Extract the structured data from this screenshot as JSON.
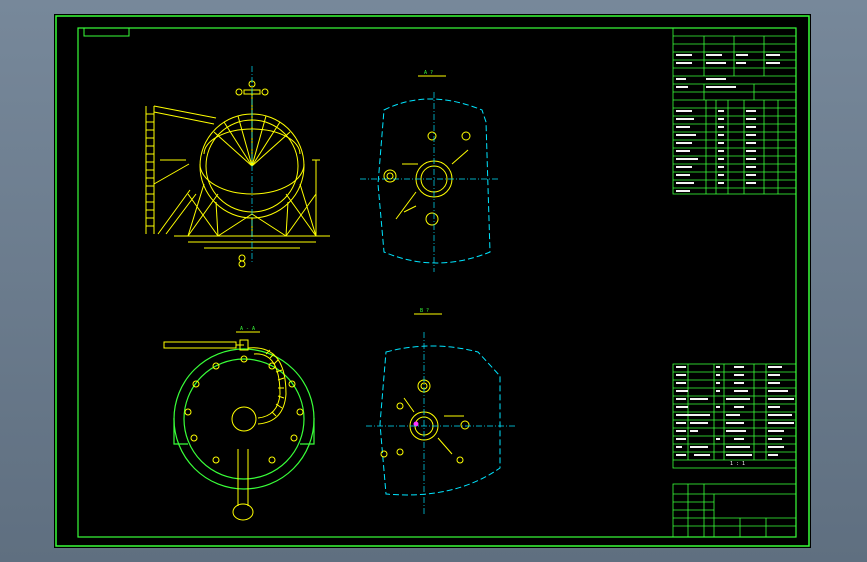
{
  "colors": {
    "frame": "#39ff39",
    "geometry": "#ffff00",
    "centerline": "#00e5ff",
    "text": "#f5f5f5",
    "accent": "#ff33ff"
  },
  "views": {
    "view_a_label": "A ?",
    "view_b_label": "B ?",
    "section_label": "A - A"
  },
  "title_block": {
    "scale_row": "1 : 1"
  }
}
